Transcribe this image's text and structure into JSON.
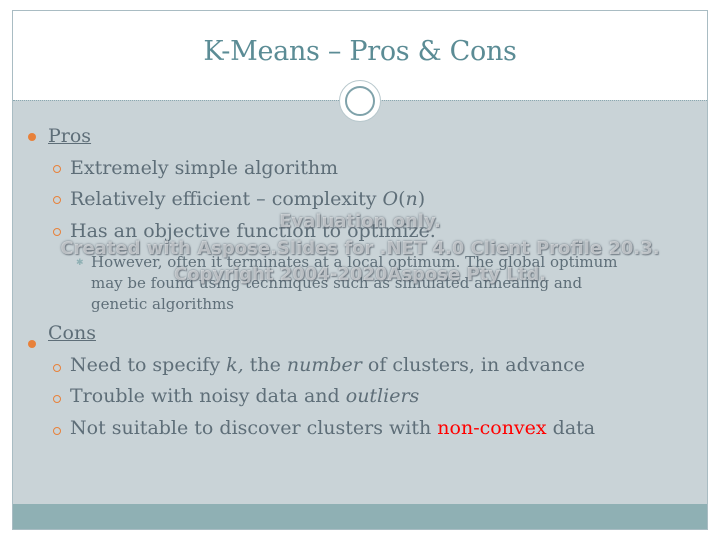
{
  "slide": {
    "title": "K-Means – Pros & Cons",
    "pros_heading": "Pros",
    "pros": [
      {
        "text": "Extremely simple algorithm"
      },
      {
        "text_before": "Relatively efficient – complexity ",
        "italic_o": "O",
        "paren_open": "(",
        "italic_n": "n",
        "paren_close": ")"
      },
      {
        "text": "Has an objective function to optimize."
      }
    ],
    "pros_sub": "However, often it terminates at a local optimum. The global optimum may be found using techniques such as simulated annealing and genetic algorithms",
    "cons_heading": "Cons",
    "cons": [
      {
        "a": "Need to specify ",
        "b": "k,",
        "c": " the ",
        "d": "number",
        "e": " of clusters, in advance"
      },
      {
        "a": "Trouble with noisy data and ",
        "b": "outliers"
      },
      {
        "a": "Not suitable to discover clusters with ",
        "b": "non-convex",
        "c": " data"
      }
    ]
  },
  "watermark": {
    "line1": "Evaluation only.",
    "line2": "Created with Aspose.Slides for .NET 4.0 Client Profile 20.3.",
    "line3": "Copyright 2004-2020Aspose Pty Ltd."
  },
  "colors": {
    "title": "#5b8c95",
    "body_text": "#5e6e78",
    "bullet": "#e8813a",
    "background": "#c9d3d7",
    "footer_band": "#8fb0b4",
    "emphasis_red": "#ff0000"
  }
}
